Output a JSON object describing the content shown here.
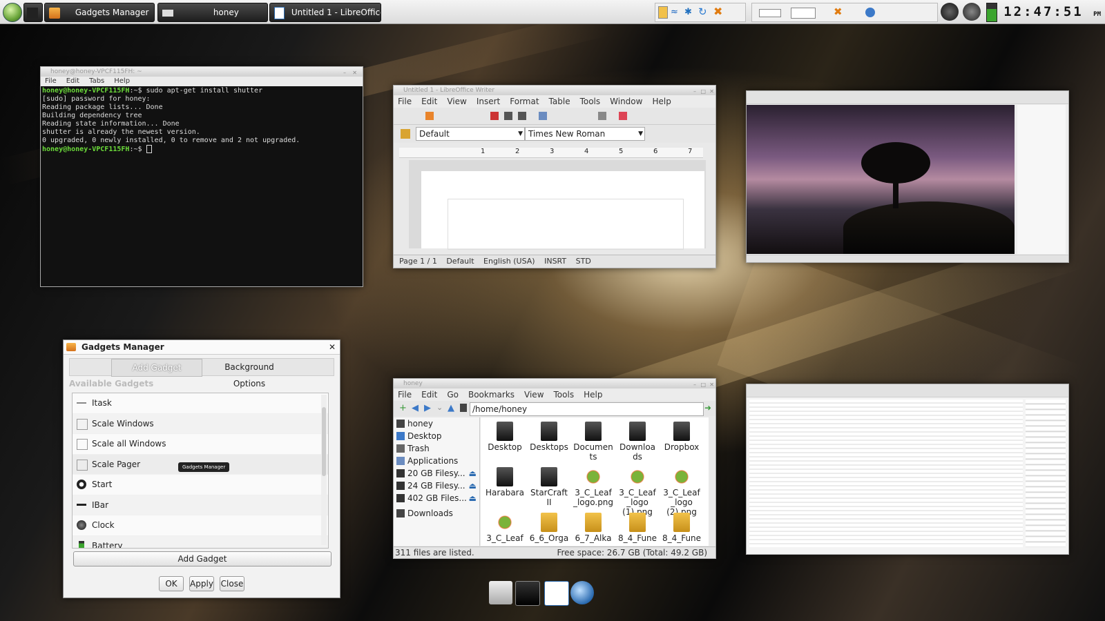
{
  "panel": {
    "tasks": [
      {
        "label": ""
      },
      {
        "label": "Gadgets Manager"
      },
      {
        "label": "honey"
      },
      {
        "label": "Untitled 1 - LibreOffice ..."
      }
    ],
    "clock": "12:47:51 ",
    "ampm": "PM"
  },
  "terminal": {
    "title": "honey@honey-VPCF115FH: ~",
    "menu": [
      "File",
      "Edit",
      "Tabs",
      "Help"
    ],
    "prompt_host": "honey@honey-VPCF115FH",
    "lines": [
      {
        "prompt": "honey@honey-VPCF115FH",
        "cmd": ":~$ sudo apt-get install shutter"
      },
      {
        "prompt": "",
        "cmd": "[sudo] password for honey:"
      },
      {
        "prompt": "",
        "cmd": "Reading package lists... Done"
      },
      {
        "prompt": "",
        "cmd": "Building dependency tree"
      },
      {
        "prompt": "",
        "cmd": "Reading state information... Done"
      },
      {
        "prompt": "",
        "cmd": "shutter is already the newest version."
      },
      {
        "prompt": "",
        "cmd": "0 upgraded, 0 newly installed, 0 to remove and 2 not upgraded."
      },
      {
        "prompt": "honey@honey-VPCF115FH",
        "cmd": ":~$ "
      }
    ]
  },
  "writer": {
    "title": "Untitled 1 - LibreOffice Writer",
    "menu": [
      "File",
      "Edit",
      "View",
      "Insert",
      "Format",
      "Table",
      "Tools",
      "Window",
      "Help"
    ],
    "style": "Default",
    "font": "Times New Roman",
    "ruler": [
      "1",
      "2",
      "3",
      "4",
      "5",
      "6",
      "7"
    ],
    "status": [
      "Page 1 / 1",
      "Default",
      "English (USA)",
      "INSRT",
      "STD"
    ]
  },
  "gadgets": {
    "title": "Gadgets Manager",
    "tabs": [
      "Add Gadget",
      "Background Options"
    ],
    "section": "Available Gadgets",
    "items": [
      "Itask",
      "Scale Windows",
      "Scale all Windows",
      "Scale Pager",
      "Start",
      "IBar",
      "Clock",
      "Battery"
    ],
    "tooltip": "Gadgets Manager",
    "add_button": "Add Gadget",
    "ok": "OK",
    "apply": "Apply",
    "close": "Close"
  },
  "files": {
    "title": "honey",
    "menu": [
      "File",
      "Edit",
      "Go",
      "Bookmarks",
      "View",
      "Tools",
      "Help"
    ],
    "path": "/home/honey",
    "sidebar": [
      "honey",
      "Desktop",
      "Trash",
      "Applications",
      "20 GB Filesy...",
      "24 GB Filesy...",
      "402 GB Files...",
      "Downloads"
    ],
    "icons": [
      {
        "label": "Desktop",
        "kind": "dark"
      },
      {
        "label": "Desktops",
        "kind": "dark"
      },
      {
        "label": "Documen ts",
        "kind": "dark"
      },
      {
        "label": "Downloa ds",
        "kind": "dark"
      },
      {
        "label": "Dropbox",
        "kind": "dark"
      },
      {
        "label": "Harabara",
        "kind": "dark"
      },
      {
        "label": "StarCraft II",
        "kind": "dark"
      },
      {
        "label": "3_C_Leaf _logo.png",
        "kind": "leaf"
      },
      {
        "label": "3_C_Leaf _logo (1).png",
        "kind": "leaf"
      },
      {
        "label": "3_C_Leaf _logo (2).png",
        "kind": "leaf"
      },
      {
        "label": "3_C_Leaf",
        "kind": "leaf"
      },
      {
        "label": "6_6_Orga",
        "kind": "gold"
      },
      {
        "label": "6_7_Alka",
        "kind": "gold"
      },
      {
        "label": "8_4_Fune",
        "kind": "gold"
      },
      {
        "label": "8_4_Fune",
        "kind": "gold"
      }
    ],
    "status_left": "311 files are listed.",
    "status_right": "Free space: 26.7 GB (Total: 49.2 GB)"
  },
  "colors": {
    "prompt": "#6cdc3a",
    "panel": "#e8e8e8"
  }
}
